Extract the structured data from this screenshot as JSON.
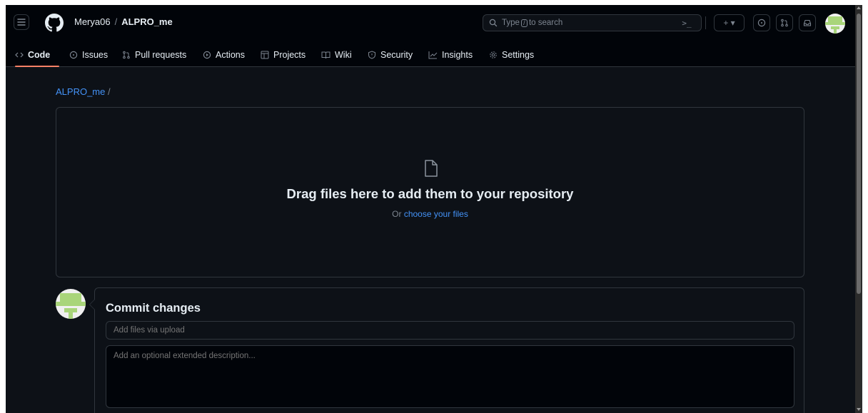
{
  "header": {
    "owner": "Merya06",
    "separator": "/",
    "repo": "ALPRO_me",
    "search_prefix": "Type",
    "search_key": "/",
    "search_suffix": "to search",
    "cmd_glyph": ">_",
    "plus_glyph": "+ ▾",
    "icons": [
      "hamburger-icon",
      "github-logo-icon",
      "search-icon",
      "command-palette-icon",
      "plus-icon",
      "issues-icon",
      "pull-request-icon",
      "inbox-icon",
      "avatar"
    ]
  },
  "tabs": [
    {
      "label": "Code",
      "icon": "code-icon"
    },
    {
      "label": "Issues",
      "icon": "issue-icon"
    },
    {
      "label": "Pull requests",
      "icon": "pull-request-icon"
    },
    {
      "label": "Actions",
      "icon": "play-icon"
    },
    {
      "label": "Projects",
      "icon": "table-icon"
    },
    {
      "label": "Wiki",
      "icon": "book-icon"
    },
    {
      "label": "Security",
      "icon": "shield-icon"
    },
    {
      "label": "Insights",
      "icon": "graph-icon"
    },
    {
      "label": "Settings",
      "icon": "gear-icon"
    }
  ],
  "main": {
    "path_link": "ALPRO_me",
    "path_slash": "/",
    "drop_title": "Drag files here to add them to your repository",
    "drop_or": "Or",
    "drop_choose": "choose your files"
  },
  "commit": {
    "title": "Commit changes",
    "summary_placeholder": "Add files via upload",
    "description_placeholder": "Add an optional extended description..."
  },
  "colors": {
    "background": "#0d1117",
    "header": "#010409",
    "border": "#30363d",
    "link": "#4493f8",
    "muted": "#7d8590",
    "active_tab_underline": "#f78166"
  }
}
